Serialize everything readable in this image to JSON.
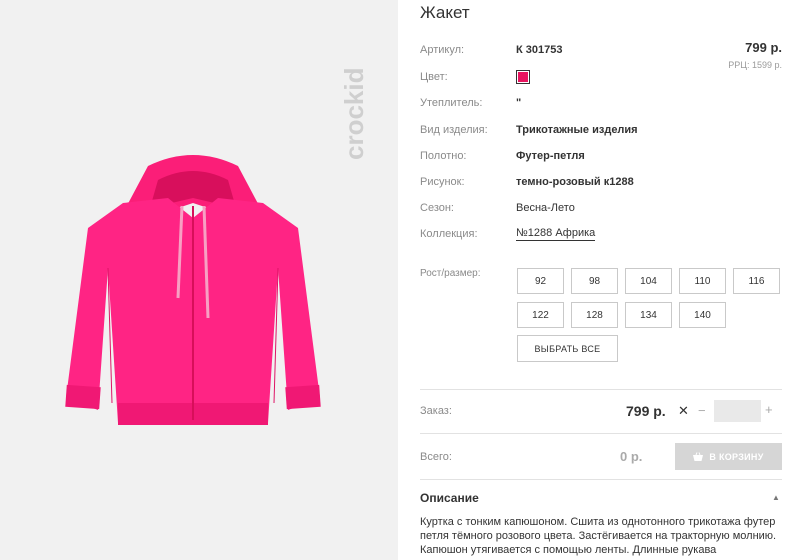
{
  "brand": {
    "vertical_logo": "crockid"
  },
  "product": {
    "title": "Жакет",
    "image_icon": "pink-zip-hoodie-image"
  },
  "props": {
    "article": {
      "label": "Артикул:",
      "value": "К 301753"
    },
    "color": {
      "label": "Цвет:",
      "swatch": "#e8145f"
    },
    "insulation": {
      "label": "Утеплитель:",
      "value": "\""
    },
    "kind": {
      "label": "Вид изделия:",
      "value": "Трикотажные изделия"
    },
    "fabric": {
      "label": "Полотно:",
      "value": "Футер-петля"
    },
    "pattern": {
      "label": "Рисунок:",
      "value": "темно-розовый к1288"
    },
    "season": {
      "label": "Сезон:",
      "value": "Весна-Лето"
    },
    "collection": {
      "label": "Коллекция:",
      "value": "№1288 Африка"
    }
  },
  "price": {
    "main": "799 р.",
    "rrc": "РРЦ: 1599 р."
  },
  "sizes": {
    "label": "Рост/размер:",
    "items": [
      "92",
      "98",
      "104",
      "110",
      "116",
      "122",
      "128",
      "134",
      "140"
    ],
    "select_all": "ВЫБРАТЬ ВСЕ"
  },
  "order": {
    "label": "Заказ:",
    "price": "799 р.",
    "times": "✕",
    "minus": "−",
    "plus": "+",
    "quantity": ""
  },
  "total": {
    "label": "Всего:",
    "value": "0 р.",
    "cart_button": "В КОРЗИНУ"
  },
  "description": {
    "title": "Описание",
    "toggle": "▲",
    "text": "Куртка с тонким капюшоном. Сшита из однотонного трикотажа футер петля тёмного розового цвета. Застёгивается на тракторную молнию. Капюшон утягивается с помощью ленты. Длинные рукава"
  },
  "colors": {
    "accent_pink": "#ff1f7a",
    "swatch": "#e8145f"
  }
}
